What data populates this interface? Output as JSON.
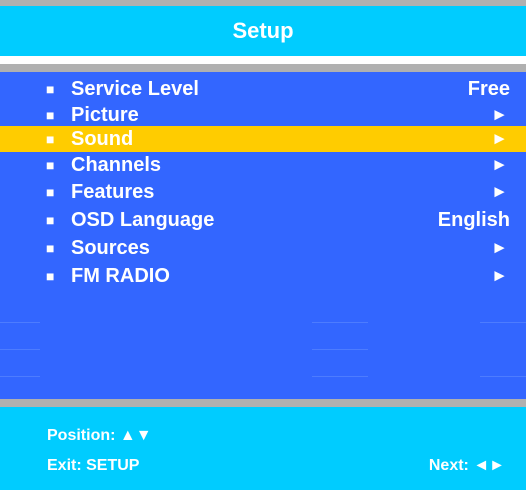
{
  "header": {
    "title": "Setup"
  },
  "menu": {
    "items": [
      {
        "label": "Service Level",
        "value": "Free"
      },
      {
        "label": "Picture",
        "value": "►"
      },
      {
        "label": "Sound",
        "value": "►"
      },
      {
        "label": "Channels",
        "value": "►"
      },
      {
        "label": "Features",
        "value": "►"
      },
      {
        "label": "OSD Language",
        "value": "English"
      },
      {
        "label": "Sources",
        "value": "►"
      },
      {
        "label": "FM RADIO",
        "value": "►"
      }
    ],
    "bullet": "■",
    "selected_index": 2
  },
  "footer": {
    "position_label": "Position: ▲▼",
    "exit_label": "Exit: SETUP",
    "next_label": "Next: ◄►"
  },
  "colors": {
    "header_bg": "#00ccff",
    "menu_bg": "#3366ff",
    "highlight": "#ffcc00",
    "strip": "#b0b0b0",
    "text": "#ffffff"
  }
}
